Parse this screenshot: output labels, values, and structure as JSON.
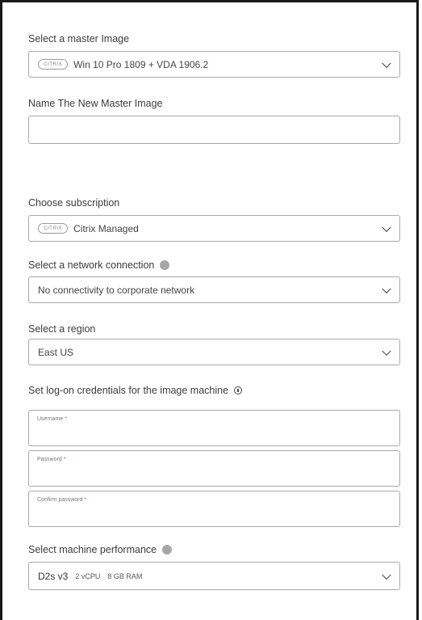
{
  "master_image": {
    "label": "Select a master Image",
    "badge": "CITRIX",
    "value": "Win 10 Pro 1809 + VDA 1906.2"
  },
  "new_master_name": {
    "label": "Name The New Master Image",
    "value": ""
  },
  "subscription": {
    "label": "Choose subscription",
    "badge": "CITRIX",
    "value": "Citrix Managed"
  },
  "network": {
    "label": "Select a network connection",
    "value": "No connectivity to corporate network"
  },
  "region": {
    "label": "Select a region",
    "value": "East US"
  },
  "credentials": {
    "label": "Set log-on credentials for the image machine",
    "username_placeholder": "Username",
    "password_placeholder": "Password",
    "confirm_placeholder": "Confirm password",
    "required_mark": "*"
  },
  "performance": {
    "label": "Select machine performance",
    "size": "D2s v3",
    "cpu": "2 vCPU",
    "ram": "8 GB RAM"
  },
  "icons": {
    "help": "help-circle-icon",
    "info": "info-icon",
    "dropdown": "chevron-down-icon"
  }
}
